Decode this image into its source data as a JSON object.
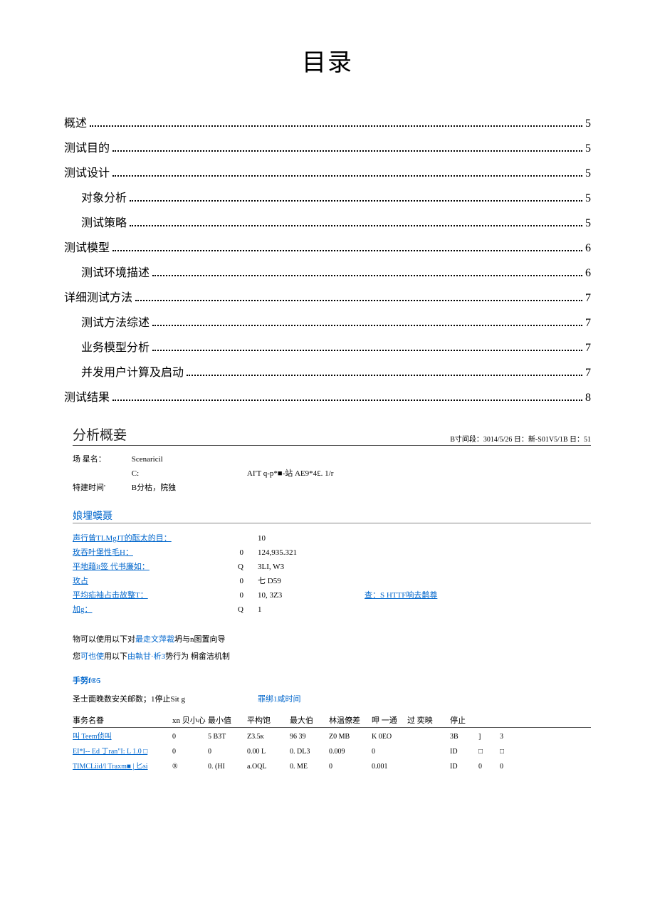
{
  "title": "目录",
  "toc": [
    {
      "label": "概述",
      "page": "5",
      "indent": false
    },
    {
      "label": "测试目的",
      "page": "5",
      "indent": false
    },
    {
      "label": "测试设计",
      "page": "5",
      "indent": false
    },
    {
      "label": "对象分析",
      "page": "5",
      "indent": true
    },
    {
      "label": "测试策略",
      "page": "5",
      "indent": true
    },
    {
      "label": "测试模型",
      "page": "6",
      "indent": false
    },
    {
      "label": "测试环境描述",
      "page": "6",
      "indent": true
    },
    {
      "label": "详细测试方法",
      "page": "7",
      "indent": false
    },
    {
      "label": "测试方法综述",
      "page": "7",
      "indent": true
    },
    {
      "label": "业务模型分析",
      "page": "7",
      "indent": true
    },
    {
      "label": "并发用户计算及启动",
      "page": "7",
      "indent": true
    },
    {
      "label": "测试结果",
      "page": "8",
      "indent": false
    }
  ],
  "analysis": {
    "title": "分析概妾",
    "subtitle": "B寸间段：3014/5/26 日：新-S01V5/1B 日：51",
    "scenario_label": "场 星名：",
    "scenario_value": "Scenaricil",
    "row2_label": "",
    "row2_v1": "C:",
    "row2_v2": "AI'T q-p*■-站  AE9*4£. 1/r",
    "time_label": "特建时间'",
    "time_value": "B分枯，院独"
  },
  "stats": {
    "heading": "娘埋蟆聂",
    "rows": [
      {
        "label": "声行曾TLMgJT的酝太的目：",
        "v0": "",
        "v1": "10",
        "link": ""
      },
      {
        "label": "玫吞叶堡性毛H：",
        "v0": "0",
        "v1": "124,935.321",
        "link": ""
      },
      {
        "label": "平地藉it签 代书廉如：",
        "v0": "Q",
        "v1": "3LI, W3",
        "link": ""
      },
      {
        "label": "玫占",
        "v0": "0",
        "v1": "七 D59",
        "link": ""
      },
      {
        "label": "平均疝袖占击故整T：",
        "v0": "0",
        "v1": "10, 3Z3",
        "link": "查：S    HTTF响去鹊尊"
      },
      {
        "label": "加g：",
        "v0": "Q",
        "v1": "1",
        "link": ""
      }
    ]
  },
  "notes": {
    "line1_pre": "物可以使用以下对",
    "line1_link": "最走文萍裁",
    "line1_post": "坍与n图置向导",
    "line2_pre": "您",
    "line2_b1": "可也使",
    "line2_mid": "用以下",
    "line2_b2": "由執甘·析3",
    "line2_post": "势行为 桐畲洁机制"
  },
  "mini_title": "手努f®5",
  "dual": {
    "left": "圣士面晚数安关邮数；1停止Sit g",
    "right": "罪绑1咸时间"
  },
  "table": {
    "headers": {
      "name": "事务名眷",
      "c1": "xn 贝小心",
      "c2": "最小值",
      "c3": "平构饱",
      "c4": "最大伯",
      "c5": "林温僚差",
      "c6": "呷 一通",
      "c7": "过 奕映",
      "c8": "停止",
      "c9": "",
      "c10": ""
    },
    "rows": [
      {
        "name": "叫 Teem侦叫",
        "c1": "0",
        "c2": "5 B3T",
        "c3": "Z3.5ᴋ",
        "c4": "96 39",
        "c5": "Z0 MB",
        "c6": "K 0EO",
        "c7": "",
        "c8": "3B",
        "c9": "]",
        "c10": "3"
      },
      {
        "name": "EI*I-- Ed 丁ran\"I:   L 1.0 □",
        "c1": "0",
        "c2": "0",
        "c3": "0.00 L",
        "c4": "0. DL3",
        "c5": "0.009",
        "c6": "0",
        "c7": "",
        "c8": "ID",
        "c9": "□",
        "c10": "□"
      },
      {
        "name": "TIMCLiid/l Traxm■ | 匕si",
        "c1": "®",
        "c2": "0. (HI",
        "c3": "a.OQL",
        "c4": "0. ME",
        "c5": "0",
        "c6": "0.001",
        "c7": "",
        "c8": "ID",
        "c9": "0",
        "c10": "0"
      }
    ]
  }
}
